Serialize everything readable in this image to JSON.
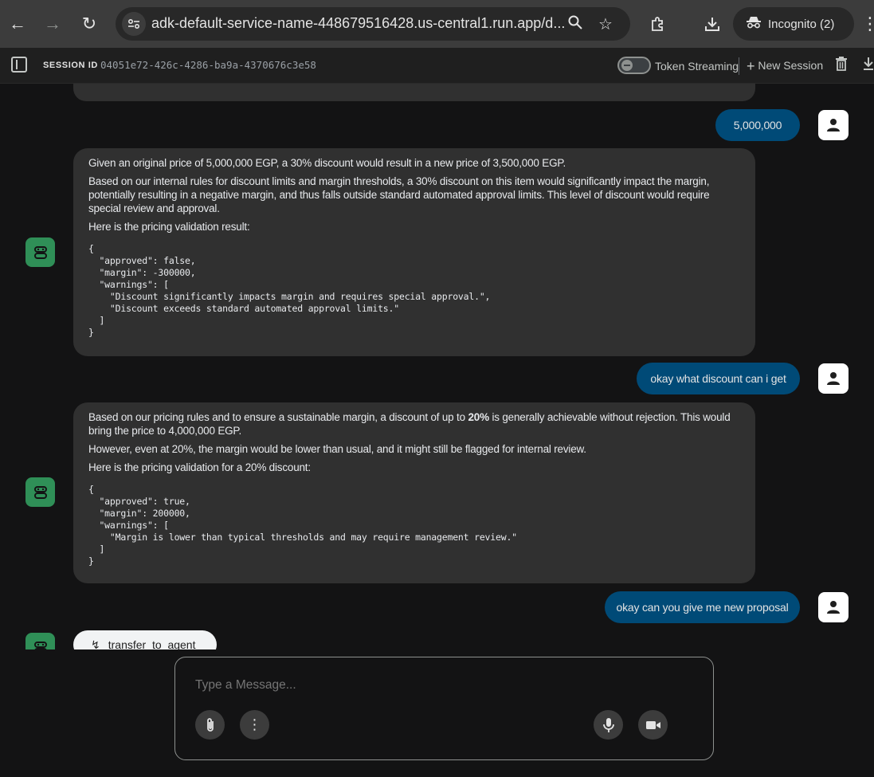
{
  "browser": {
    "url": "adk-default-service-name-448679516428.us-central1.run.app/d...",
    "incognito_label": "Incognito (2)"
  },
  "header": {
    "session_label": "SESSION ID",
    "session_id": "04051e72-426c-4286-ba9a-4370676c3e58",
    "token_streaming_label": "Token Streaming",
    "token_streaming_on": false,
    "new_session_label": "New Session"
  },
  "messages": {
    "user1": "5,000,000",
    "bot1": {
      "p1": "Given an original price of 5,000,000 EGP, a 30% discount would result in a new price of 3,500,000 EGP.",
      "p2": "Based on our internal rules for discount limits and margin thresholds, a 30% discount on this item would significantly impact the margin, potentially resulting in a negative margin, and thus falls outside standard automated approval limits. This level of discount would require special review and approval.",
      "p3": "Here is the pricing validation result:",
      "code": "{\n  \"approved\": false,\n  \"margin\": -300000,\n  \"warnings\": [\n    \"Discount significantly impacts margin and requires special approval.\",\n    \"Discount exceeds standard automated approval limits.\"\n  ]\n}"
    },
    "user2": "okay what discount can i get",
    "bot2": {
      "p1_a": "Based on our pricing rules and to ensure a sustainable margin, a discount of up to ",
      "p1_bold": "20%",
      "p1_b": " is generally achievable without rejection. This would bring the price to 4,000,000 EGP.",
      "p2": "However, even at 20%, the margin would be lower than usual, and it might still be flagged for internal review.",
      "p3": "Here is the pricing validation for a 20% discount:",
      "code": "{\n  \"approved\": true,\n  \"margin\": 200000,\n  \"warnings\": [\n    \"Margin is lower than typical thresholds and may require management review.\"\n  ]\n}"
    },
    "user3": "okay can you give me new proposal",
    "tool_call": "transfer_to_agent"
  },
  "input": {
    "placeholder": "Type a Message..."
  },
  "colors": {
    "user_bubble": "#004a77",
    "bot_bubble": "#303030",
    "bot_avatar": "#2f8f57",
    "background": "#131314"
  }
}
